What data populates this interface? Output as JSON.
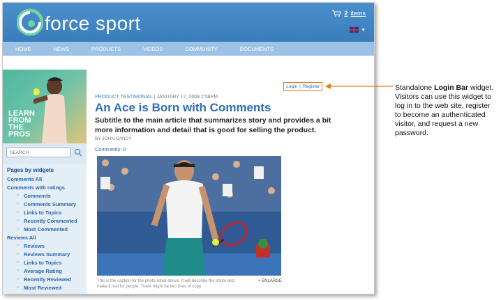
{
  "header": {
    "logo_text": "force sport",
    "cart_count": "2",
    "cart_label": "items"
  },
  "nav": [
    "HOME",
    "NEWS",
    "PRODUCTS",
    "VIDEOS",
    "COMMUNITY",
    "DOCUMENTS"
  ],
  "promo": {
    "line1": "LEARN",
    "line2": "FROM",
    "line3": "THE",
    "line4": "PROS"
  },
  "search": {
    "placeholder": "SEARCH"
  },
  "widgets": {
    "heading": "Pages by widgets",
    "items": [
      {
        "label": "Comments All",
        "level": 0
      },
      {
        "label": "Comments with ratings",
        "level": 0
      },
      {
        "label": "Comments",
        "level": 1
      },
      {
        "label": "Comments Summary",
        "level": 1
      },
      {
        "label": "Links to Topics",
        "level": 1
      },
      {
        "label": "Recently Commented",
        "level": 1
      },
      {
        "label": "Most Commented",
        "level": 1
      },
      {
        "label": "Reviews All",
        "level": 0
      },
      {
        "label": "Reviews",
        "level": 1
      },
      {
        "label": "Reviews Summary",
        "level": 1
      },
      {
        "label": "Links to Topics",
        "level": 1
      },
      {
        "label": "Average Rating",
        "level": 1
      },
      {
        "label": "Recently Reviewed",
        "level": 1
      },
      {
        "label": "Most Reviewed",
        "level": 1
      }
    ]
  },
  "login_bar": {
    "login": "Login",
    "separator": "|",
    "register": "Register"
  },
  "article": {
    "category": "PRODUCT TESTIMONIAL",
    "date": "JANUARY 17, 2009 2:58PM",
    "title": "An Ace is Born with Comments",
    "subtitle": "Subtitle to the main article that summarizes story and provides a bit more information and detail that is good for selling the product.",
    "byline": "BY JOHN CANDY",
    "comments": "Comments: 0",
    "caption": "This is the caption for the photo listed above. It will describe the photo and make it real for people. There might be two lines of copy.",
    "enlarge": "+ ENLARGE"
  },
  "annotation": {
    "prefix": "Standalone ",
    "bold": "Login Bar",
    "rest": " widget. Visitors can use this widget to log in to the web site, register to become an authenticated visitor, and request a new password."
  },
  "colors": {
    "header_blue": "#3a7dbd",
    "nav_blue": "#9cc3e6",
    "title_blue": "#2e6db1",
    "callout_orange": "#e47b1a"
  }
}
